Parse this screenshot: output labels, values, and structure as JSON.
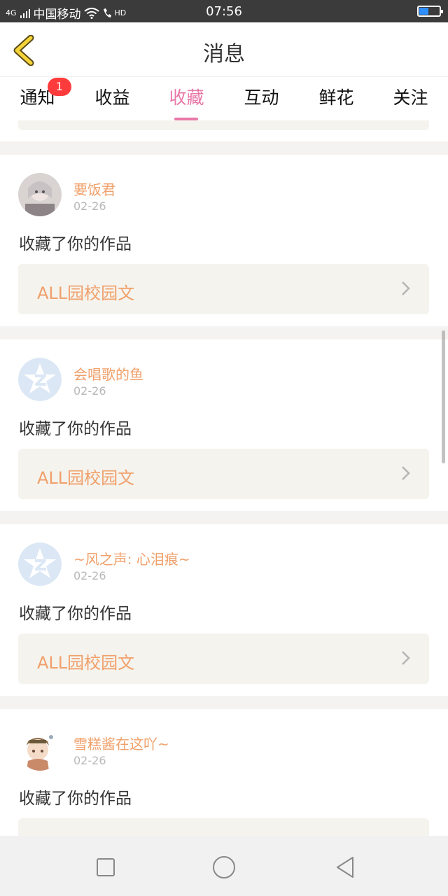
{
  "status": {
    "carrier": "中国移动",
    "network": "4G",
    "hd": "HD",
    "time": "07:56",
    "battery_level": 0.45
  },
  "header": {
    "title": "消息",
    "back_icon": "back-chevron-icon"
  },
  "tabs": [
    {
      "label": "通知",
      "badge": "1",
      "active": false
    },
    {
      "label": "收益",
      "active": false
    },
    {
      "label": "收藏",
      "active": true
    },
    {
      "label": "互动",
      "active": false
    },
    {
      "label": "鲜花",
      "active": false
    },
    {
      "label": "关注",
      "active": false
    }
  ],
  "colors": {
    "accent": "#e878a8",
    "username": "#f0a06a",
    "badge": "#ff3b3b"
  },
  "items": [
    {
      "user": "要饭君",
      "date": "02-26",
      "action": "收藏了你的作品",
      "work": "ALL园校园文",
      "avatar": "photo-avatar"
    },
    {
      "user": "会唱歌的鱼",
      "date": "02-26",
      "action": "收藏了你的作品",
      "work": "ALL园校园文",
      "avatar": "default-star-avatar"
    },
    {
      "user": "~风之声: 心泪痕~",
      "date": "02-26",
      "action": "收藏了你的作品",
      "work": "ALL园校园文",
      "avatar": "default-star-avatar"
    },
    {
      "user": "雪糕酱在这吖~",
      "date": "02-26",
      "action": "收藏了你的作品",
      "work": "",
      "avatar": "anime-avatar"
    }
  ],
  "navbar": {
    "icons": [
      "square-recent-icon",
      "circle-home-icon",
      "triangle-back-icon"
    ]
  }
}
